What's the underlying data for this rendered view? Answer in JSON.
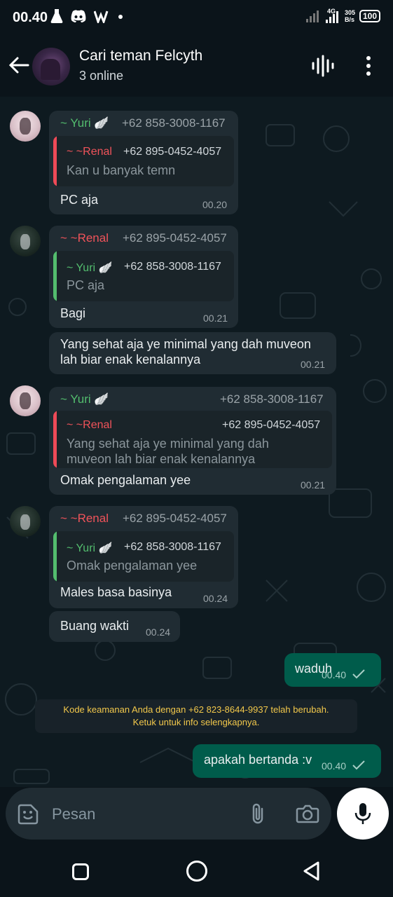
{
  "status_bar": {
    "time": "00.40",
    "network_type": "4G",
    "speed_value": "305",
    "speed_unit": "B/s",
    "battery": "100"
  },
  "header": {
    "title": "Cari teman Felcyth",
    "subtitle": "3 online"
  },
  "messages": [
    {
      "sender": "~ Yuri 🪽",
      "phone": "+62 858-3008-1167",
      "quote": {
        "name": "~ ~Renal",
        "phone": "+62 895-0452-4057",
        "text": "Kan u banyak temn"
      },
      "text": "PC aja",
      "time": "00.20"
    },
    {
      "sender": "~ ~Renal",
      "phone": "+62 895-0452-4057",
      "quote": {
        "name": "~ Yuri 🪽",
        "phone": "+62 858-3008-1167",
        "text": "PC aja"
      },
      "text": "Bagi",
      "time": "00.21"
    },
    {
      "text_line1": "Yang sehat aja ye minimal yang dah muveon",
      "text_line2": "lah biar enak kenalannya",
      "time": "00.21"
    },
    {
      "sender": "~ Yuri 🪽",
      "phone": "+62 858-3008-1167",
      "quote": {
        "name": "~ ~Renal",
        "phone": "+62 895-0452-4057",
        "text_line1": "Yang sehat aja ye minimal yang dah",
        "text_line2": "muveon lah biar enak kenalannya"
      },
      "text": "Omak pengalaman yee",
      "time": "00.21"
    },
    {
      "sender": "~ ~Renal",
      "phone": "+62 895-0452-4057",
      "quote": {
        "name": "~ Yuri 🪽",
        "phone": "+62 858-3008-1167",
        "text": "Omak pengalaman yee"
      },
      "text": "Males basa basinya",
      "time": "00.24"
    },
    {
      "text": "Buang wakti",
      "time": "00.24"
    },
    {
      "text": "waduh",
      "time": "00.40"
    },
    {
      "text": "apakah bertanda :v",
      "time": "00.40"
    }
  ],
  "system_note": {
    "line1": "Kode keamanan Anda dengan +62 823-8644-9937 telah berubah.",
    "line2": "Ketuk untuk info selengkapnya."
  },
  "composer": {
    "placeholder": "Pesan"
  },
  "colors": {
    "chat_bg": "#0e1a20",
    "incoming_bubble": "#202c33",
    "outgoing_bubble": "#005c4b",
    "green_name": "#53bd6e",
    "red_name": "#f0535a",
    "system_text": "#f2c84b"
  }
}
